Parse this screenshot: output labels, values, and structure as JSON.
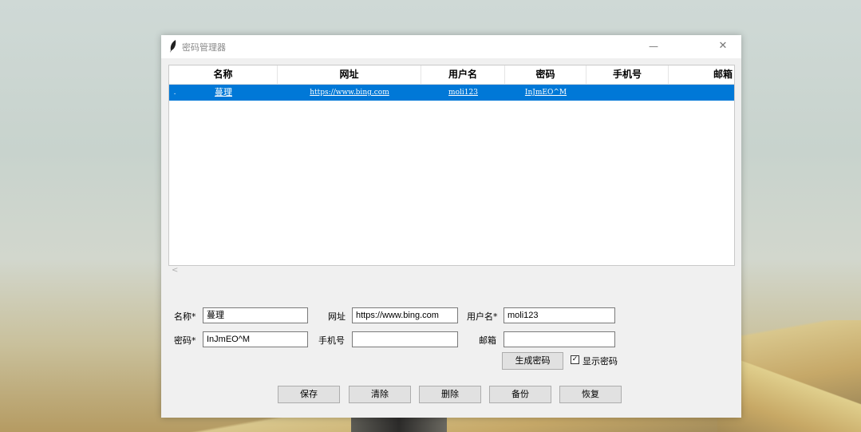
{
  "window": {
    "title": "密码管理器",
    "minimize": "—",
    "close": "✕"
  },
  "table": {
    "columns": [
      "名称",
      "网址",
      "用户名",
      "密码",
      "手机号",
      "邮箱"
    ],
    "rows": [
      {
        "marker": ".",
        "name": "蔓理",
        "url": "https://www.bing.com",
        "username": "moli123",
        "password": "InJmEO^M",
        "phone": "",
        "email": ""
      }
    ],
    "scroll_left": "<"
  },
  "form": {
    "name_label": "名称*",
    "name_value": "蔓理",
    "url_label": "网址",
    "url_value": "https://www.bing.com",
    "username_label": "用户名*",
    "username_value": "moli123",
    "password_label": "密码*",
    "password_value": "InJmEO^M",
    "phone_label": "手机号",
    "phone_value": "",
    "email_label": "邮箱",
    "email_value": "",
    "generate_button": "生成密码",
    "show_password_label": "显示密码",
    "show_password_checked": "✓"
  },
  "actions": {
    "save": "保存",
    "clear": "清除",
    "delete": "删除",
    "backup": "备份",
    "restore": "恢复"
  },
  "colors": {
    "selection": "#0078d7",
    "window_bg": "#f0f0f0"
  }
}
